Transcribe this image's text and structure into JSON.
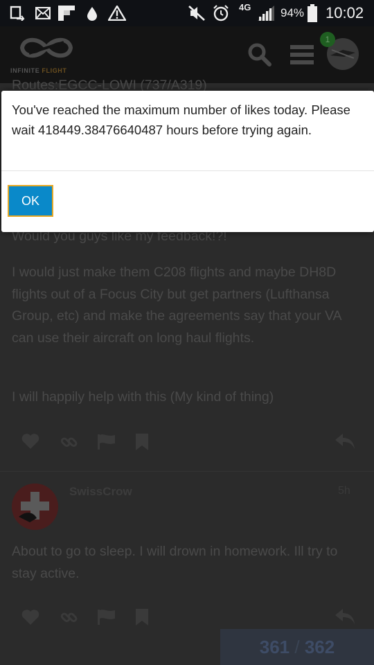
{
  "status_bar": {
    "network": "4G",
    "battery_percent": "94%",
    "time": "10:02",
    "icons": [
      "screenshot-icon",
      "mail-icon",
      "flipboard-icon",
      "drop-icon",
      "warning-icon",
      "mute-icon",
      "alarm-icon",
      "signal-icon",
      "battery-icon"
    ]
  },
  "header": {
    "logo_text_main": "INFINITE ",
    "logo_text_accent": "FLIGHT",
    "notification_count": "1",
    "icons": [
      "infinite-flight-logo-icon",
      "search-icon",
      "hamburger-menu-icon",
      "user-avatar"
    ]
  },
  "topic": {
    "partial_title": "Routes:EGCC-LOWI (737/A319)",
    "partial_question": "Would you guys like my feedback!?!",
    "reply_paragraph_1": "I would just make them C208 flights and maybe DH8D flights out of a Focus City but get partners (Lufthansa Group, etc) and make the agreements say that your VA can use their aircraft on long haul flights.",
    "reply_paragraph_2": "I will happily help with this (My kind of thing)",
    "next_post": {
      "username": "SwissCrow",
      "time": "5h",
      "body": "About to go to sleep. I will drown in homework. Ill try to stay active."
    },
    "progress": {
      "current": "361",
      "separator": "/",
      "total": "362"
    }
  },
  "modal": {
    "message": "You've reached the maximum number of likes today. Please wait 418449.38476640487 hours before trying again.",
    "ok_label": "OK"
  },
  "colors": {
    "modal_button": "#0a89c9",
    "modal_button_border": "#e8a822",
    "overlay": "#2b2b2b"
  }
}
